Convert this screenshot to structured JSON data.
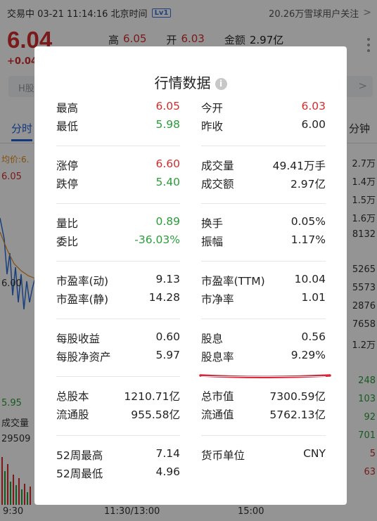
{
  "status": {
    "trade_status": "交易中 03-21 11:14:16 北京时间",
    "level_badge": "Lv1",
    "followers": "20.26万雪球用户关注",
    "chevron": ">"
  },
  "quote": {
    "price": "6.04",
    "change": "+0.04",
    "high_label": "高",
    "high_value": "6.05",
    "open_label": "开",
    "open_value": "6.03",
    "amount_label": "金额",
    "amount_value": "2.97亿"
  },
  "search": {
    "text": "H股",
    "arrow": ">"
  },
  "tabs": {
    "intraday": "分时",
    "minutes": "分钟"
  },
  "chart_labels": {
    "avg": "均价:6.",
    "price_605": "6.05",
    "price_600": "6.00",
    "price_595": "5.95",
    "volume_label": "成交量",
    "volume_value": "29509"
  },
  "right_column": [
    {
      "text": "2.7万",
      "color": "dark"
    },
    {
      "text": "1.4万",
      "color": "dark"
    },
    {
      "text": "1.5万",
      "color": "dark"
    },
    {
      "text": "1.6万",
      "color": "dark"
    },
    {
      "text": "8132",
      "color": "dark"
    },
    {
      "text": "5265",
      "color": "dark"
    },
    {
      "text": "5573",
      "color": "dark"
    },
    {
      "text": "2876",
      "color": "dark"
    },
    {
      "text": "7658",
      "color": "dark"
    },
    {
      "text": "1.2万",
      "color": "dark"
    },
    {
      "text": "248",
      "color": "green"
    },
    {
      "text": "103",
      "color": "green"
    },
    {
      "text": "92",
      "color": "green"
    },
    {
      "text": "701",
      "color": "green"
    },
    {
      "text": "5",
      "color": "red"
    },
    {
      "text": "63",
      "color": "red"
    }
  ],
  "time_axis": {
    "start": "9:30",
    "mid": "11:30/13:00",
    "later": "15:00"
  },
  "dialog": {
    "title": "行情数据",
    "info_icon": "i",
    "groups": [
      {
        "left": [
          {
            "label": "最高",
            "value": "6.05",
            "color": "red"
          },
          {
            "label": "最低",
            "value": "5.98",
            "color": "green"
          }
        ],
        "right": [
          {
            "label": "今开",
            "value": "6.03",
            "color": "red"
          },
          {
            "label": "昨收",
            "value": "6.00",
            "color": "dark"
          }
        ]
      },
      {
        "left": [
          {
            "label": "涨停",
            "value": "6.60",
            "color": "red"
          },
          {
            "label": "跌停",
            "value": "5.40",
            "color": "green"
          }
        ],
        "right": [
          {
            "label": "成交量",
            "value": "49.41万手",
            "color": "dark"
          },
          {
            "label": "成交额",
            "value": "2.97亿",
            "color": "dark"
          }
        ]
      },
      {
        "left": [
          {
            "label": "量比",
            "value": "0.89",
            "color": "green"
          },
          {
            "label": "委比",
            "value": "-36.03%",
            "color": "green"
          }
        ],
        "right": [
          {
            "label": "换手",
            "value": "0.05%",
            "color": "dark"
          },
          {
            "label": "振幅",
            "value": "1.17%",
            "color": "dark"
          }
        ]
      },
      {
        "left": [
          {
            "label": "市盈率(动)",
            "value": "9.13",
            "color": "dark"
          },
          {
            "label": "市盈率(静)",
            "value": "14.28",
            "color": "dark"
          }
        ],
        "right": [
          {
            "label": "市盈率(TTM)",
            "value": "10.04",
            "color": "dark"
          },
          {
            "label": "市净率",
            "value": "1.01",
            "color": "dark"
          }
        ]
      },
      {
        "left": [
          {
            "label": "每股收益",
            "value": "0.60",
            "color": "dark"
          },
          {
            "label": "每股净资产",
            "value": "5.97",
            "color": "dark"
          }
        ],
        "right": [
          {
            "label": "股息",
            "value": "0.56",
            "color": "dark"
          },
          {
            "label": "股息率",
            "value": "9.29%",
            "color": "dark"
          }
        ]
      },
      {
        "left": [
          {
            "label": "总股本",
            "value": "1210.71亿",
            "color": "dark"
          },
          {
            "label": "流通股",
            "value": "955.58亿",
            "color": "dark"
          }
        ],
        "right": [
          {
            "label": "总市值",
            "value": "7300.59亿",
            "color": "dark"
          },
          {
            "label": "流通值",
            "value": "5762.13亿",
            "color": "dark"
          }
        ]
      },
      {
        "left": [
          {
            "label": "52周最高",
            "value": "7.14",
            "color": "dark"
          },
          {
            "label": "52周最低",
            "value": "4.96",
            "color": "dark"
          }
        ],
        "right": [
          {
            "label": "货币单位",
            "value": "CNY",
            "color": "dark"
          }
        ]
      }
    ]
  },
  "colors": {
    "up": "#d22d2d",
    "down": "#2a9d3a",
    "accent": "#1f5fd8",
    "annotation": "#d8263a"
  }
}
